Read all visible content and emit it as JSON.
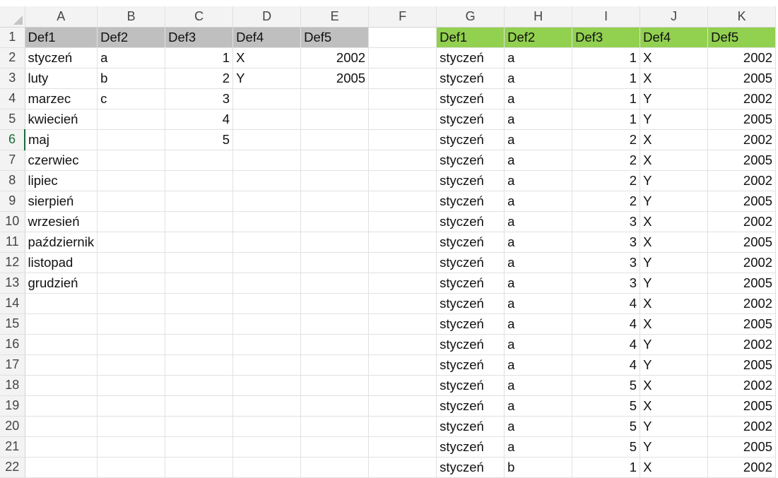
{
  "columns": [
    "A",
    "B",
    "C",
    "D",
    "E",
    "F",
    "G",
    "H",
    "I",
    "J",
    "K"
  ],
  "header_styles": {
    "gray": "#bfbfbf",
    "green": "#92d050"
  },
  "selected_row": 6,
  "rows": [
    {
      "n": "1",
      "cells": [
        "Def1",
        "Def2",
        "Def3",
        "Def4",
        "Def5",
        "",
        "Def1",
        "Def2",
        "Def3",
        "Def4",
        "Def5"
      ]
    },
    {
      "n": "2",
      "cells": [
        "styczeń",
        "a",
        "1",
        "X",
        "2002",
        "",
        "styczeń",
        "a",
        "1",
        "X",
        "2002"
      ]
    },
    {
      "n": "3",
      "cells": [
        "luty",
        "b",
        "2",
        "Y",
        "2005",
        "",
        "styczeń",
        "a",
        "1",
        "X",
        "2005"
      ]
    },
    {
      "n": "4",
      "cells": [
        "marzec",
        "c",
        "3",
        "",
        "",
        "",
        "styczeń",
        "a",
        "1",
        "Y",
        "2002"
      ]
    },
    {
      "n": "5",
      "cells": [
        "kwiecień",
        "",
        "4",
        "",
        "",
        "",
        "styczeń",
        "a",
        "1",
        "Y",
        "2005"
      ]
    },
    {
      "n": "6",
      "cells": [
        "maj",
        "",
        "5",
        "",
        "",
        "",
        "styczeń",
        "a",
        "2",
        "X",
        "2002"
      ]
    },
    {
      "n": "7",
      "cells": [
        "czerwiec",
        "",
        "",
        "",
        "",
        "",
        "styczeń",
        "a",
        "2",
        "X",
        "2005"
      ]
    },
    {
      "n": "8",
      "cells": [
        "lipiec",
        "",
        "",
        "",
        "",
        "",
        "styczeń",
        "a",
        "2",
        "Y",
        "2002"
      ]
    },
    {
      "n": "9",
      "cells": [
        "sierpień",
        "",
        "",
        "",
        "",
        "",
        "styczeń",
        "a",
        "2",
        "Y",
        "2005"
      ]
    },
    {
      "n": "10",
      "cells": [
        "wrzesień",
        "",
        "",
        "",
        "",
        "",
        "styczeń",
        "a",
        "3",
        "X",
        "2002"
      ]
    },
    {
      "n": "11",
      "cells": [
        "październik",
        "",
        "",
        "",
        "",
        "",
        "styczeń",
        "a",
        "3",
        "X",
        "2005"
      ]
    },
    {
      "n": "12",
      "cells": [
        "listopad",
        "",
        "",
        "",
        "",
        "",
        "styczeń",
        "a",
        "3",
        "Y",
        "2002"
      ]
    },
    {
      "n": "13",
      "cells": [
        "grudzień",
        "",
        "",
        "",
        "",
        "",
        "styczeń",
        "a",
        "3",
        "Y",
        "2005"
      ]
    },
    {
      "n": "14",
      "cells": [
        "",
        "",
        "",
        "",
        "",
        "",
        "styczeń",
        "a",
        "4",
        "X",
        "2002"
      ]
    },
    {
      "n": "15",
      "cells": [
        "",
        "",
        "",
        "",
        "",
        "",
        "styczeń",
        "a",
        "4",
        "X",
        "2005"
      ]
    },
    {
      "n": "16",
      "cells": [
        "",
        "",
        "",
        "",
        "",
        "",
        "styczeń",
        "a",
        "4",
        "Y",
        "2002"
      ]
    },
    {
      "n": "17",
      "cells": [
        "",
        "",
        "",
        "",
        "",
        "",
        "styczeń",
        "a",
        "4",
        "Y",
        "2005"
      ]
    },
    {
      "n": "18",
      "cells": [
        "",
        "",
        "",
        "",
        "",
        "",
        "styczeń",
        "a",
        "5",
        "X",
        "2002"
      ]
    },
    {
      "n": "19",
      "cells": [
        "",
        "",
        "",
        "",
        "",
        "",
        "styczeń",
        "a",
        "5",
        "X",
        "2005"
      ]
    },
    {
      "n": "20",
      "cells": [
        "",
        "",
        "",
        "",
        "",
        "",
        "styczeń",
        "a",
        "5",
        "Y",
        "2002"
      ]
    },
    {
      "n": "21",
      "cells": [
        "",
        "",
        "",
        "",
        "",
        "",
        "styczeń",
        "a",
        "5",
        "Y",
        "2005"
      ]
    },
    {
      "n": "22",
      "cells": [
        "",
        "",
        "",
        "",
        "",
        "",
        "styczeń",
        "b",
        "1",
        "X",
        "2002"
      ]
    }
  ]
}
